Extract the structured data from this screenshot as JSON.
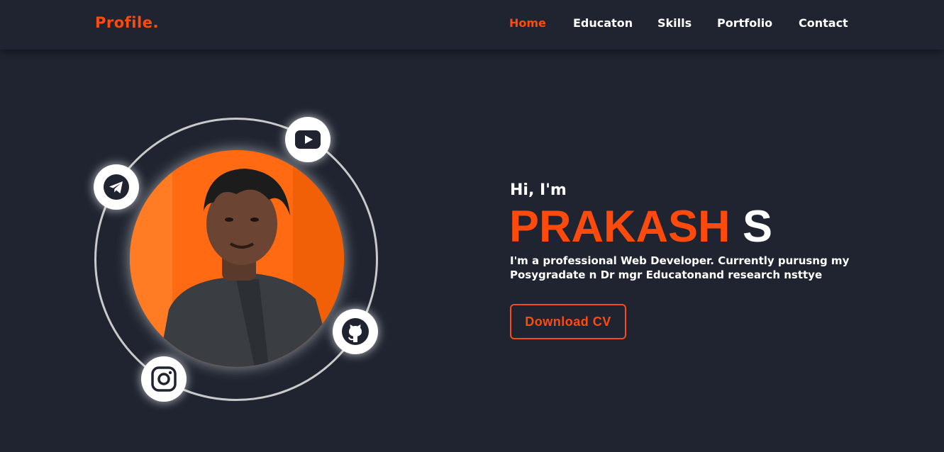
{
  "header": {
    "logo": "Profile.",
    "nav": [
      {
        "label": "Home",
        "active": true
      },
      {
        "label": "Educaton",
        "active": false
      },
      {
        "label": "Skills",
        "active": false
      },
      {
        "label": "Portfolio",
        "active": false
      },
      {
        "label": "Contact",
        "active": false
      }
    ]
  },
  "hero": {
    "greeting": "Hi, I'm",
    "name_first": "PRAKASH",
    "name_last": "S",
    "description": "I'm a professional Web Developer. Currently purusng my Posygradate n Dr mgr Educatonand research nsttye",
    "cta_label": "Download CV"
  },
  "social": [
    {
      "icon": "youtube-icon"
    },
    {
      "icon": "telegram-icon"
    },
    {
      "icon": "github-icon"
    },
    {
      "icon": "instagram-icon"
    }
  ],
  "colors": {
    "background": "#1f2430",
    "accent": "#ff4a0d",
    "text": "#ffffff"
  }
}
